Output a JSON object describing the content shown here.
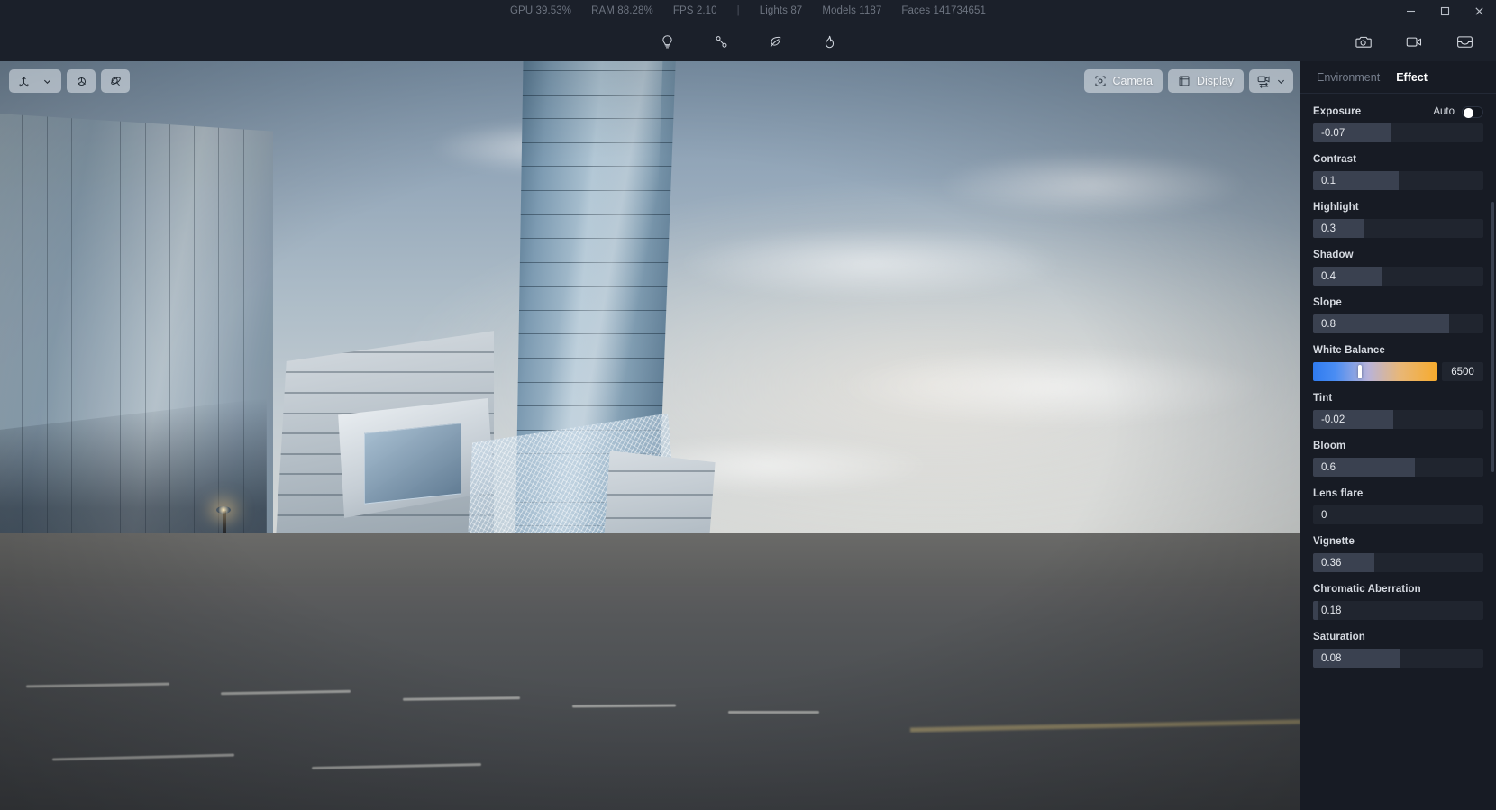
{
  "window": {
    "controls": [
      {
        "name": "minimize",
        "glyph": "minimize-icon"
      },
      {
        "name": "maximize",
        "glyph": "maximize-icon"
      },
      {
        "name": "close",
        "glyph": "close-icon"
      }
    ]
  },
  "stats": {
    "gpu": "GPU 39.53%",
    "ram": "RAM 88.28%",
    "fps": "FPS 2.10",
    "separator": "|",
    "lights": "Lights 87",
    "models": "Models 1187",
    "faces": "Faces 141734651"
  },
  "toolbar": {
    "center_tools": [
      {
        "name": "light-icon",
        "label": "Light"
      },
      {
        "name": "measure-icon",
        "label": "Measure"
      },
      {
        "name": "leaf-icon",
        "label": "Vegetation"
      },
      {
        "name": "flame-icon",
        "label": "Effects"
      }
    ],
    "right_tools": [
      {
        "name": "camera-snapshot-icon",
        "label": "Snapshot"
      },
      {
        "name": "video-record-icon",
        "label": "Record"
      },
      {
        "name": "gallery-inbox-icon",
        "label": "Gallery"
      }
    ]
  },
  "viewport": {
    "left_tools": [
      {
        "name": "move-gizmo-icon",
        "label": "Transform"
      },
      {
        "name": "chevron-down-icon",
        "label": "More"
      },
      {
        "name": "rotate-gizmo-icon",
        "label": "Rotate"
      },
      {
        "name": "orbit-icon",
        "label": "Orbit"
      }
    ],
    "camera_button": "Camera",
    "display_button": "Display",
    "view_switch_label": ""
  },
  "panel": {
    "tabs": [
      {
        "label": "Environment",
        "active": false
      },
      {
        "label": "Effect",
        "active": true
      }
    ],
    "exposure": {
      "label": "Exposure",
      "auto_label": "Auto",
      "auto_on": false,
      "value": "-0.07",
      "fill_percent": 46
    },
    "controls": [
      {
        "label": "Contrast",
        "value": "0.1",
        "fill_percent": 50
      },
      {
        "label": "Highlight",
        "value": "0.3",
        "fill_percent": 30
      },
      {
        "label": "Shadow",
        "value": "0.4",
        "fill_percent": 40
      },
      {
        "label": "Slope",
        "value": "0.8",
        "fill_percent": 80
      }
    ],
    "white_balance": {
      "label": "White Balance",
      "value": "6500",
      "handle_percent": 38,
      "gradient_from": "#2f7bf0",
      "gradient_to": "#f7ab2e"
    },
    "controls_lower": [
      {
        "label": "Tint",
        "value": "-0.02",
        "fill_percent": 47
      },
      {
        "label": "Bloom",
        "value": "0.6",
        "fill_percent": 60
      },
      {
        "label": "Lens flare",
        "value": "0",
        "fill_percent": 0
      },
      {
        "label": "Vignette",
        "value": "0.36",
        "fill_percent": 36
      },
      {
        "label": "Chromatic Aberration",
        "value": "0.18",
        "fill_percent": 3
      },
      {
        "label": "Saturation",
        "value": "0.08",
        "fill_percent": 51
      }
    ]
  },
  "colors": {
    "panel_bg": "#171b24",
    "app_bg": "#1b202a",
    "slider_track": "#20252f",
    "slider_fill": "#3a4150",
    "accent_text": "#ffffff"
  }
}
